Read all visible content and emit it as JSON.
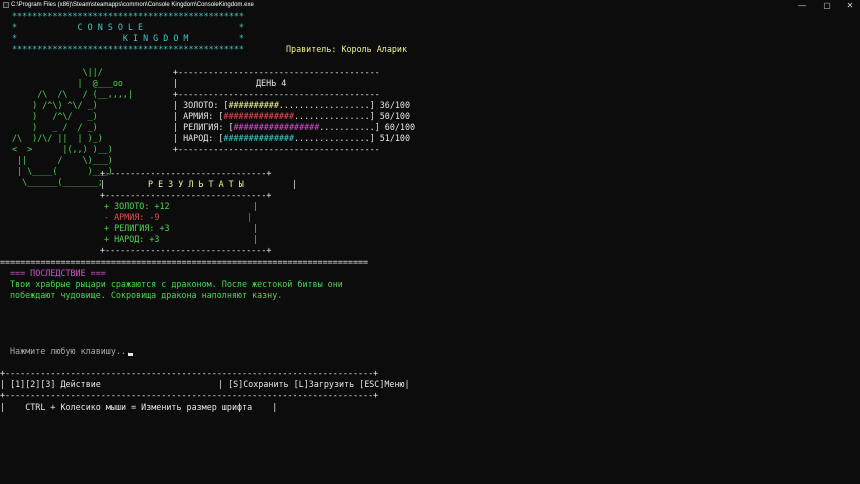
{
  "window": {
    "title": "C:\\Program Files (x86)\\Steam\\steamapps\\common\\Console Kingdom\\ConsoleKingdom.exe",
    "minimize": "—",
    "maximize": "▢",
    "close": "✕"
  },
  "banner": {
    "border": "**********************************************",
    "line1": "*            C O N S O L E                   *",
    "line2": "*                     K I N G D O M          *",
    "border2": "********************************************** "
  },
  "ruler": "Правитель: Король Аларик",
  "art": [
    "              \\||/",
    "             |  @___oo",
    "     /\\  /\\   / (__,,,,|",
    "    ) /^\\) ^\\/ _)",
    "    )   /^\\/   _)",
    "    )   _ /  / _)",
    "/\\  )/\\/ ||  | )_)",
    "<  >      |(,,) )__)",
    " ||      /    \\)___)",
    " | \\____(      )___)",
    "  \\______(_______;"
  ],
  "status": {
    "border": "+----------------------------------------",
    "day": "ДЕНЬ 4",
    "resources": [
      {
        "label": "| ЗОЛОТО: [",
        "bar": "##########",
        "empty": "..................",
        "tail": "] 36/100"
      },
      {
        "label": "| АРМИЯ: [",
        "bar": "##############",
        "empty": "...............",
        "tail": "] 50/100"
      },
      {
        "label": "| РЕЛИГИЯ: [",
        "bar": "#################",
        "empty": "...........",
        "tail": "] 60/100"
      },
      {
        "label": "| НАРОД: [",
        "bar": "##############",
        "empty": "...............",
        "tail": "] 51/100"
      }
    ]
  },
  "results": {
    "border": "+--------------------------------+",
    "title": "Р Е З У Л Ь Т А Т Ы",
    "items": [
      {
        "text": "+ ЗОЛОТО: +12",
        "kind": "plus"
      },
      {
        "text": "- АРМИЯ: -9",
        "kind": "minus"
      },
      {
        "text": "+ РЕЛИГИЯ: +3",
        "kind": "plus"
      },
      {
        "text": "+ НАРОД: +3",
        "kind": "plus"
      }
    ]
  },
  "divider": "=========================================================================",
  "consequence": {
    "header": "=== ПОСЛЕДСТВИЕ ===",
    "line1": "Твои храбрые рыцари сражаются с драконом. После жестокой битвы они",
    "line2": "побеждают чудовище. Сокровища дракона наполняют казну."
  },
  "prompt": "Нажмите любую клавишу...",
  "footer": {
    "border": "+-------------------------------------------------------------------------+",
    "left": "| [1][2][3] Действие",
    "right": "| [S]Сохранить [L]Загрузить [ESC]Меню|",
    "hint": "|    CTRL + Колесико мыши = Изменить размер шрифта    |"
  }
}
